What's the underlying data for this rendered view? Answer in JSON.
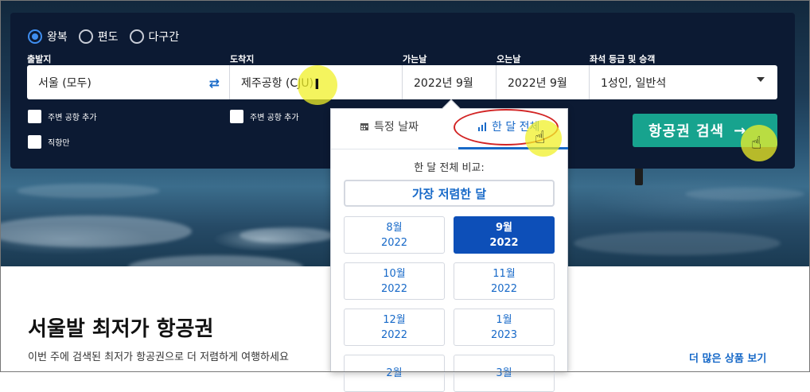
{
  "trip_type": {
    "options": [
      "왕복",
      "편도",
      "다구간"
    ],
    "selected": "왕복"
  },
  "fields": {
    "origin_label": "출발지",
    "origin_value": "서울 (모두)",
    "destination_label": "도착지",
    "destination_value": "제주공항 (CJU)",
    "depart_label": "가는날",
    "depart_value": "2022년 9월",
    "return_label": "오는날",
    "return_value": "2022년 9월",
    "cabin_label": "좌석 등급 및 승객",
    "cabin_value": "1성인, 일반석"
  },
  "checkboxes": {
    "origin_nearby": "주변 공항 추가",
    "destination_nearby": "주변 공항 추가",
    "direct_only": "직항만"
  },
  "search_button": {
    "label": "항공권 검색",
    "arrow": "→"
  },
  "calendar": {
    "tab_specific": "특정 날짜",
    "tab_month": "한 달 전체",
    "compare_label": "한 달 전체 비교:",
    "cheapest_button": "가장 저렴한 달",
    "months": [
      {
        "month": "8월",
        "year": "2022",
        "selected": false
      },
      {
        "month": "9월",
        "year": "2022",
        "selected": true
      },
      {
        "month": "10월",
        "year": "2022",
        "selected": false
      },
      {
        "month": "11월",
        "year": "2022",
        "selected": false
      },
      {
        "month": "12월",
        "year": "2022",
        "selected": false
      },
      {
        "month": "1월",
        "year": "2023",
        "selected": false
      },
      {
        "month": "2월",
        "year": "",
        "selected": false
      },
      {
        "month": "3월",
        "year": "",
        "selected": false
      }
    ]
  },
  "deals": {
    "title": "서울발 최저가 항공권",
    "subtitle": "이번 주에 검색된 최저가 항공권으로 더 저렴하게 여행하세요",
    "more_link": "더 많은 상품 보기"
  },
  "colors": {
    "panel": "#0c1a33",
    "accent_blue": "#1769c8",
    "search_green": "#17a38e",
    "selected_month": "#0d4fb8",
    "annotation_red": "#d22424",
    "highlight_yellow": "#f0f028"
  }
}
